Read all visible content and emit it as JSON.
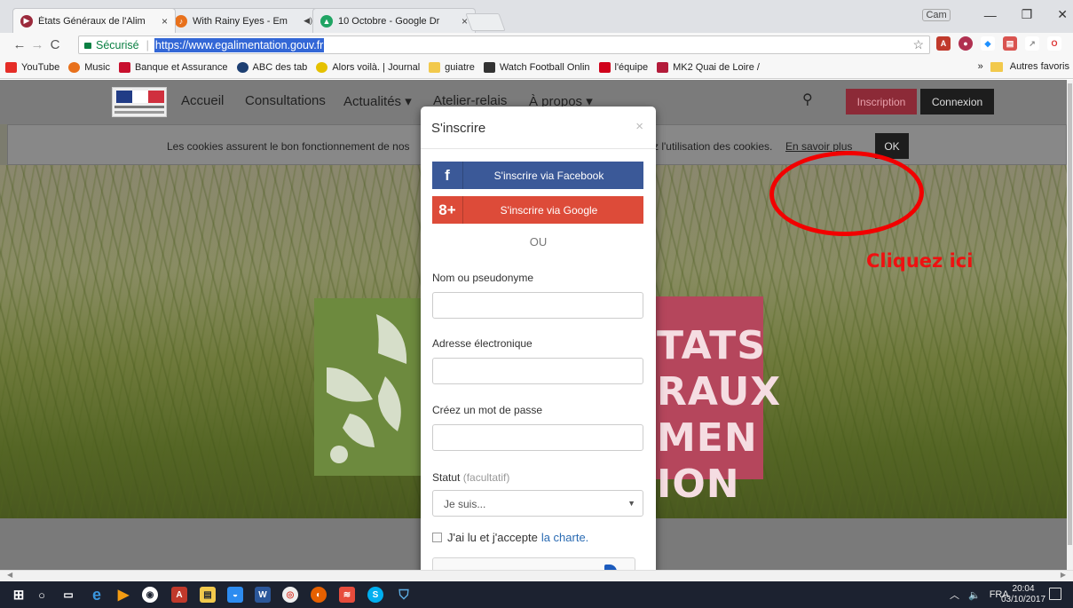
{
  "browser": {
    "tabs": [
      {
        "title": "États Généraux de l'Alim",
        "active": true
      },
      {
        "title": "With Rainy Eyes - Em",
        "active": false
      },
      {
        "title": "10 Octobre - Google Dr",
        "active": false
      }
    ],
    "user_label": "Cam",
    "security_label": "Sécurisé",
    "url": "https://www.egalimentation.gouv.fr",
    "bookmarks": [
      "YouTube",
      "Music",
      "Banque et Assurance",
      "ABC des tab",
      "Alors voilà. | Journal",
      "guiatre",
      "Watch Football Onlin",
      "l'équipe",
      "MK2 Quai de Loire /"
    ],
    "bookmark_overflow": "»",
    "other_bookmarks": "Autres favoris"
  },
  "site": {
    "nav": [
      "Accueil",
      "Consultations",
      "Actualités ▾",
      "Atelier-relais",
      "À propos ▾"
    ],
    "inscription": "Inscription",
    "connexion": "Connexion",
    "cookie_text": "Les cookies assurent le bon fonctionnement de nos",
    "cookie_text_end": "z l'utilisation des cookies.",
    "cookie_more": "En savoir plus",
    "cookie_ok": "OK",
    "hero_text": "TATS\nRAUX\nMEN\nION"
  },
  "modal": {
    "title": "S'inscrire",
    "close": "×",
    "facebook_icon": "f",
    "facebook_label": "S'inscrire via Facebook",
    "google_icon": "8+",
    "google_label": "S'inscrire via Google",
    "separator": "OU",
    "name_label": "Nom ou pseudonyme",
    "email_label": "Adresse électronique",
    "password_label": "Créez un mot de passe",
    "status_label": "Statut",
    "status_optional": "(facultatif)",
    "status_selected": "Je suis...",
    "terms_text": "J'ai lu et j'accepte",
    "terms_link": "la charte."
  },
  "annotation": {
    "label": "Cliquez ici",
    "color": "#f20000"
  },
  "taskbar": {
    "language": "FRA",
    "time": "20:04",
    "date": "03/10/2017"
  },
  "colors": {
    "facebook": "#3b5998",
    "google": "#dd4b39",
    "inscription": "#8c2a37",
    "connexion": "#1d1d1d"
  }
}
